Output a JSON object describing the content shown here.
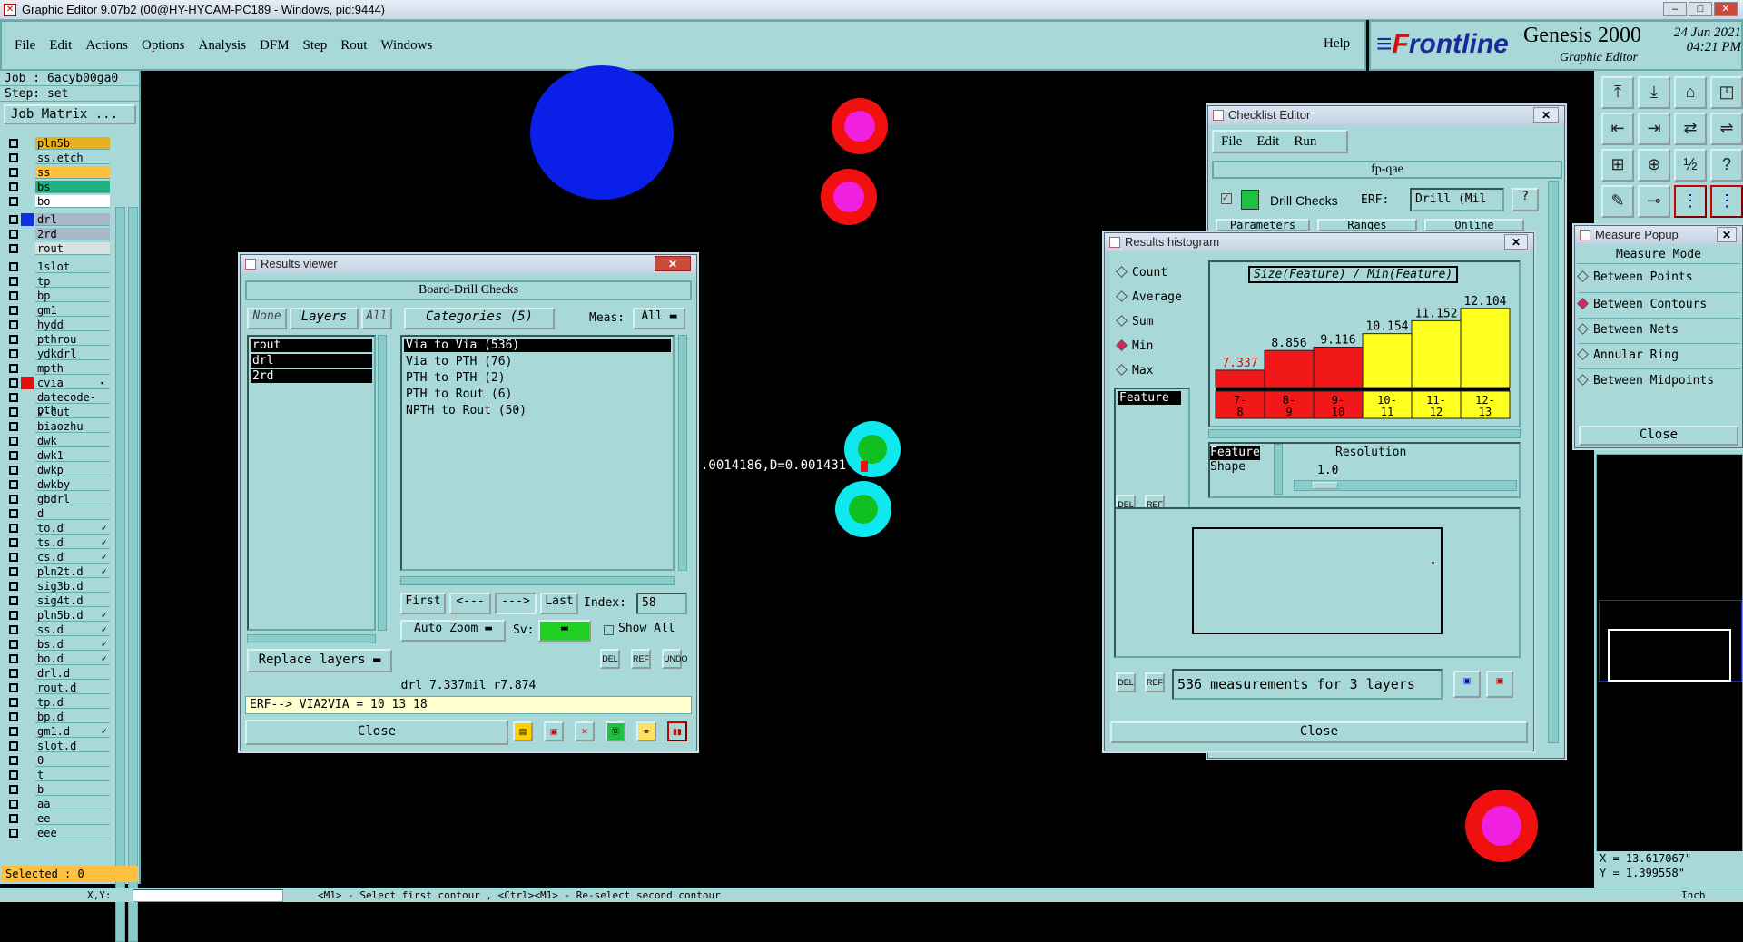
{
  "app": {
    "title": "Graphic Editor 9.07b2 (00@HY-HYCAM-PC189 - Windows, pid:9444)"
  },
  "menu": {
    "items": [
      "File",
      "Edit",
      "Actions",
      "Options",
      "Analysis",
      "DFM",
      "Step",
      "Rout",
      "Windows"
    ],
    "help": "Help"
  },
  "brand": {
    "logo_f": "F",
    "logo_rest": "rontline",
    "product": "Genesis 2000",
    "subtitle": "Graphic Editor",
    "date": "24 Jun 2021",
    "time": "04:21 PM"
  },
  "left": {
    "job": "Job : 6acyb00ga0",
    "step": "Step: set",
    "job_matrix": "Job Matrix ...",
    "selected": "Selected : 0",
    "layers": [
      {
        "name": "pln5b",
        "color": "#e8b020"
      },
      {
        "name": "ss.etch",
        "color": ""
      },
      {
        "name": "ss",
        "color": "#ffc040"
      },
      {
        "name": "bs",
        "color": "#20b080"
      },
      {
        "name": "bo",
        "color": "#ffffff"
      },
      {
        "name": "drl",
        "color": "#a8b8c8",
        "swatch": "#1030e0"
      },
      {
        "name": "2rd",
        "color": "#a8b8c8"
      },
      {
        "name": "rout",
        "color": "#d8e0e0"
      },
      {
        "name": "1slot",
        "color": ""
      },
      {
        "name": "tp",
        "color": ""
      },
      {
        "name": "bp",
        "color": ""
      },
      {
        "name": "gm1",
        "color": ""
      },
      {
        "name": "hydd",
        "color": ""
      },
      {
        "name": "pthrou",
        "color": ""
      },
      {
        "name": "ydkdrl",
        "color": ""
      },
      {
        "name": "mpth",
        "color": ""
      },
      {
        "name": "cvia",
        "color": "",
        "swatch": "#e01010",
        "flag": "▪"
      },
      {
        "name": "datecode-pth",
        "color": ""
      },
      {
        "name": "v-cut",
        "color": ""
      },
      {
        "name": "biaozhu",
        "color": ""
      },
      {
        "name": "dwk",
        "color": ""
      },
      {
        "name": "dwk1",
        "color": ""
      },
      {
        "name": "dwkp",
        "color": ""
      },
      {
        "name": "dwkby",
        "color": ""
      },
      {
        "name": "gbdrl",
        "color": ""
      },
      {
        "name": "d",
        "color": ""
      },
      {
        "name": "to.d",
        "color": "",
        "flag": "✓"
      },
      {
        "name": "ts.d",
        "color": "",
        "flag": "✓"
      },
      {
        "name": "cs.d",
        "color": "",
        "flag": "✓"
      },
      {
        "name": "pln2t.d",
        "color": "",
        "flag": "✓"
      },
      {
        "name": "sig3b.d",
        "color": ""
      },
      {
        "name": "sig4t.d",
        "color": ""
      },
      {
        "name": "pln5b.d",
        "color": "",
        "flag": "✓"
      },
      {
        "name": "ss.d",
        "color": "",
        "flag": "✓"
      },
      {
        "name": "bs.d",
        "color": "",
        "flag": "✓"
      },
      {
        "name": "bo.d",
        "color": "",
        "flag": "✓"
      },
      {
        "name": "drl.d",
        "color": ""
      },
      {
        "name": "rout.d",
        "color": ""
      },
      {
        "name": "tp.d",
        "color": ""
      },
      {
        "name": "bp.d",
        "color": ""
      },
      {
        "name": "gm1.d",
        "color": "",
        "flag": "✓"
      },
      {
        "name": "slot.d",
        "color": ""
      },
      {
        "name": "0",
        "color": ""
      },
      {
        "name": "t",
        "color": ""
      },
      {
        "name": "b",
        "color": ""
      },
      {
        "name": "aa",
        "color": ""
      },
      {
        "name": "ee",
        "color": ""
      },
      {
        "name": "eee",
        "color": ""
      }
    ]
  },
  "canvas": {
    "measure_text": ".0014186,D=0.001431"
  },
  "status": {
    "xy_label": "X,Y:",
    "message": "<M1> - Select first contour , <Ctrl><M1> - Re-select second contour",
    "units": "Inch"
  },
  "results_viewer": {
    "title": "Results viewer",
    "header": "Board-Drill Checks",
    "none": "None",
    "layers_btn": "Layers",
    "all": "All",
    "categories": "Categories (5)",
    "meas_label": "Meas:",
    "meas_value": "All",
    "layer_items": [
      "rout",
      "drl",
      "2rd"
    ],
    "category_items": [
      "Via to Via  (536)",
      "Via to PTH  (76)",
      "PTH to PTH  (2)",
      "PTH to Rout  (6)",
      "NPTH to Rout  (50)"
    ],
    "first": "First",
    "prev": "<---",
    "next": "--->",
    "last": "Last",
    "index_label": "Index:",
    "index_value": "58",
    "auto_zoom": "Auto Zoom",
    "sv_label": "Sv:",
    "show_all": "Show All",
    "replace_layers": "Replace layers",
    "info": "drl 7.337mil  r7.874",
    "erf": "ERF--> VIA2VIA = 10 13 18",
    "close": "Close",
    "del": "DEL",
    "ref": "REF",
    "undo": "UNDO"
  },
  "checklist": {
    "title": "Checklist Editor",
    "menu": [
      "File",
      "Edit",
      "Run"
    ],
    "name": "fp-qae",
    "check": "Drill Checks",
    "erf_label": "ERF:",
    "erf_value": "Drill (Mil",
    "tabs": [
      "Parameters",
      "Ranges",
      "Online"
    ]
  },
  "histogram": {
    "title": "Results histogram",
    "modes": [
      "Count",
      "Average",
      "Sum",
      "Min",
      "Max"
    ],
    "selected_mode": "Min",
    "chart_title": "Size(Feature) / Min(Feature)",
    "feature_label": "Feature",
    "feature_shape": [
      "Feature",
      "Shape"
    ],
    "resolution_label": "Resolution",
    "resolution_value": "1.0",
    "summary": "536 measurements for 3 layers",
    "close": "Close",
    "del": "DEL",
    "ref": "REF",
    "colors": {
      "red": "#f01818",
      "yellow": "#ffff20"
    }
  },
  "chart_data": {
    "type": "bar",
    "title": "Size(Feature) / Min(Feature)",
    "categories": [
      "7-8",
      "8-9",
      "9-10",
      "10-11",
      "11-12",
      "12-13"
    ],
    "values": [
      7.337,
      8.856,
      9.116,
      10.154,
      11.152,
      12.104
    ],
    "bar_colors": [
      "#f01818",
      "#f01818",
      "#f01818",
      "#ffff20",
      "#ffff20",
      "#ffff20"
    ],
    "ylim": [
      0,
      13
    ]
  },
  "measure": {
    "title": "Measure Popup",
    "mode_label": "Measure Mode",
    "modes": [
      "Between Points",
      "Between Contours",
      "Between Nets",
      "Annular Ring",
      "Between Midpoints"
    ],
    "selected": "Between Contours",
    "close": "Close"
  },
  "coords": {
    "x": "X = 13.617067\"",
    "y": "Y = 1.399558\""
  }
}
